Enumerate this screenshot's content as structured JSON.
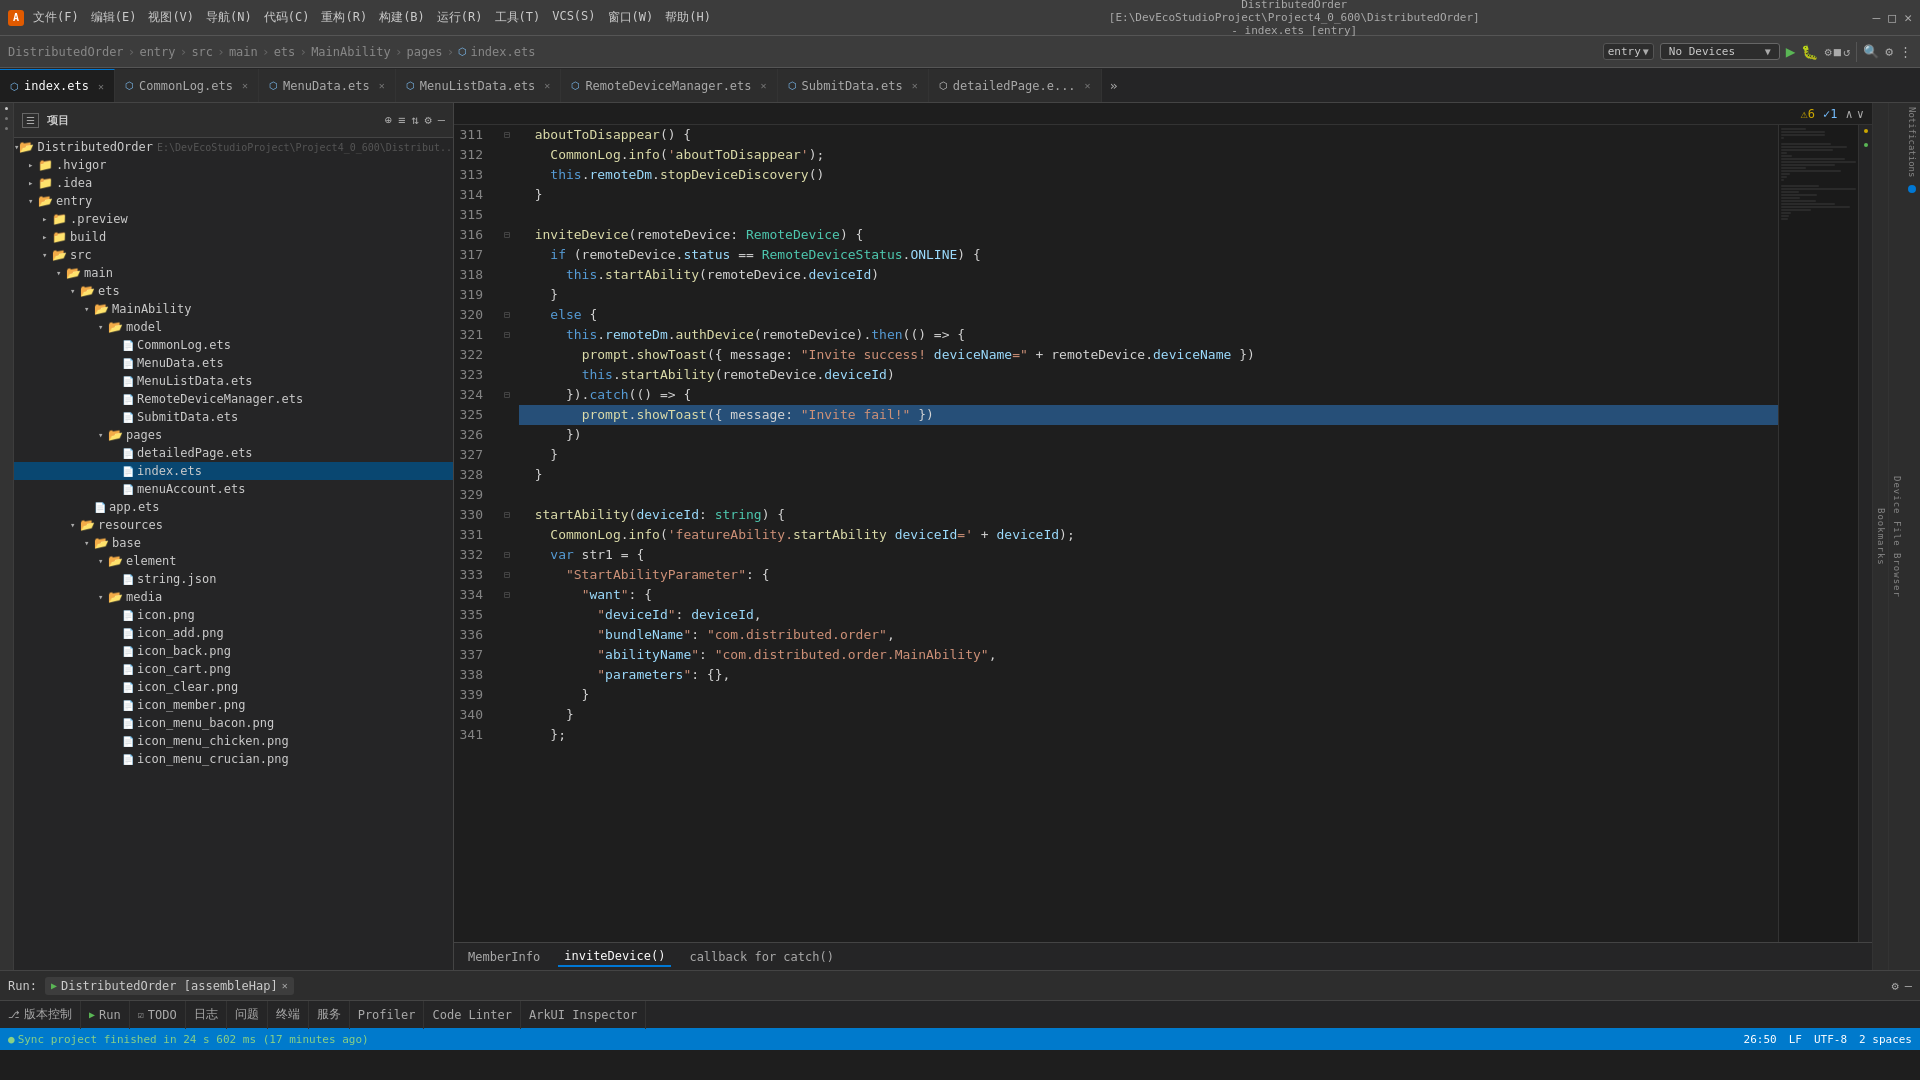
{
  "titleBar": {
    "logo": "A",
    "menus": [
      "文件(F)",
      "编辑(E)",
      "视图(V)",
      "导航(N)",
      "代码(C)",
      "重构(R)",
      "构建(B)",
      "运行(R)",
      "工具(T)",
      "VCS(S)",
      "窗口(W)",
      "帮助(H)"
    ],
    "path": "DistributedOrder [E:\\DevEcoStudioProject\\Project4_0_600\\DistributedOrder] - index.ets [entry]",
    "controls": [
      "—",
      "□",
      "✕"
    ]
  },
  "breadcrumb": {
    "items": [
      "DistributedOrder",
      "entry",
      "src",
      "main",
      "ets",
      "MainAbility",
      "pages",
      "index.ets"
    ]
  },
  "toolbar": {
    "entry_label": "entry",
    "no_devices": "No Devices",
    "run_label": "▶",
    "icons": [
      "⚙",
      "🔍",
      "⚙"
    ]
  },
  "tabs": [
    {
      "label": "index.ets",
      "active": true,
      "modified": false
    },
    {
      "label": "CommonLog.ets",
      "active": false,
      "modified": false
    },
    {
      "label": "MenuData.ets",
      "active": false,
      "modified": false
    },
    {
      "label": "MenuListData.ets",
      "active": false,
      "modified": false
    },
    {
      "label": "RemoteDeviceManager.ets",
      "active": false,
      "modified": false
    },
    {
      "label": "SubmitData.ets",
      "active": false,
      "modified": false
    },
    {
      "label": "detailedPage.e...",
      "active": false,
      "modified": false
    }
  ],
  "warnings": {
    "warn_count": "6",
    "info_count": "1"
  },
  "sidebar": {
    "header": "项目",
    "tree": [
      {
        "indent": 0,
        "type": "folder",
        "open": true,
        "label": "DistributedOrder",
        "extra": "E:\\DevEcoStudioProject\\Project4_0_600\\Distribut..."
      },
      {
        "indent": 1,
        "type": "folder",
        "open": false,
        "label": ".hvigor"
      },
      {
        "indent": 1,
        "type": "folder",
        "open": false,
        "label": ".idea"
      },
      {
        "indent": 1,
        "type": "folder",
        "open": true,
        "label": "entry"
      },
      {
        "indent": 2,
        "type": "folder",
        "open": false,
        "label": ".preview"
      },
      {
        "indent": 2,
        "type": "folder",
        "open": false,
        "label": "build"
      },
      {
        "indent": 2,
        "type": "folder",
        "open": true,
        "label": "src"
      },
      {
        "indent": 3,
        "type": "folder",
        "open": true,
        "label": "main"
      },
      {
        "indent": 4,
        "type": "folder",
        "open": true,
        "label": "ets"
      },
      {
        "indent": 5,
        "type": "folder",
        "open": true,
        "label": "MainAbility"
      },
      {
        "indent": 6,
        "type": "folder",
        "open": true,
        "label": "model"
      },
      {
        "indent": 7,
        "type": "file",
        "label": "CommonLog.ets"
      },
      {
        "indent": 7,
        "type": "file",
        "label": "MenuData.ets"
      },
      {
        "indent": 7,
        "type": "file",
        "label": "MenuListData.ets"
      },
      {
        "indent": 7,
        "type": "file",
        "label": "RemoteDeviceManager.ets"
      },
      {
        "indent": 7,
        "type": "file",
        "label": "SubmitData.ets"
      },
      {
        "indent": 6,
        "type": "folder",
        "open": true,
        "label": "pages"
      },
      {
        "indent": 7,
        "type": "file",
        "label": "detailedPage.ets"
      },
      {
        "indent": 7,
        "type": "file",
        "label": "index.ets",
        "active": true
      },
      {
        "indent": 7,
        "type": "file",
        "label": "menuAccount.ets"
      },
      {
        "indent": 5,
        "type": "file",
        "label": "app.ets"
      },
      {
        "indent": 4,
        "type": "folder",
        "open": true,
        "label": "resources"
      },
      {
        "indent": 5,
        "type": "folder",
        "open": true,
        "label": "base"
      },
      {
        "indent": 6,
        "type": "folder",
        "open": true,
        "label": "element"
      },
      {
        "indent": 7,
        "type": "file",
        "label": "string.json"
      },
      {
        "indent": 6,
        "type": "folder",
        "open": true,
        "label": "media"
      },
      {
        "indent": 7,
        "type": "file",
        "label": "icon.png"
      },
      {
        "indent": 7,
        "type": "file",
        "label": "icon_add.png"
      },
      {
        "indent": 7,
        "type": "file",
        "label": "icon_back.png"
      },
      {
        "indent": 7,
        "type": "file",
        "label": "icon_cart.png"
      },
      {
        "indent": 7,
        "type": "file",
        "label": "icon_clear.png"
      },
      {
        "indent": 7,
        "type": "file",
        "label": "icon_member.png"
      },
      {
        "indent": 7,
        "type": "file",
        "label": "icon_menu_bacon.png"
      },
      {
        "indent": 7,
        "type": "file",
        "label": "icon_menu_chicken.png"
      },
      {
        "indent": 7,
        "type": "file",
        "label": "icon_menu_crucian.png"
      }
    ]
  },
  "codeLines": [
    {
      "num": 311,
      "content": "  aboutToDisappear() {"
    },
    {
      "num": 312,
      "content": "    CommonLog.info('aboutToDisappear');"
    },
    {
      "num": 313,
      "content": "    this.remoteDm.stopDeviceDiscovery()"
    },
    {
      "num": 314,
      "content": "  }"
    },
    {
      "num": 315,
      "content": ""
    },
    {
      "num": 316,
      "content": "  inviteDevice(remoteDevice: RemoteDevice) {"
    },
    {
      "num": 317,
      "content": "    if (remoteDevice.status == RemoteDeviceStatus.ONLINE) {"
    },
    {
      "num": 318,
      "content": "      this.startAbility(remoteDevice.deviceId)"
    },
    {
      "num": 319,
      "content": "    }"
    },
    {
      "num": 320,
      "content": "    else {"
    },
    {
      "num": 321,
      "content": "      this.remoteDm.authDevice(remoteDevice).then(() => {"
    },
    {
      "num": 322,
      "content": "        prompt.showToast({ message: \"Invite success! deviceName=\" + remoteDevice.deviceName })"
    },
    {
      "num": 323,
      "content": "        this.startAbility(remoteDevice.deviceId)"
    },
    {
      "num": 324,
      "content": "      }).catch(() => {"
    },
    {
      "num": 325,
      "content": "        prompt.showToast({ message: \"Invite fail!\" })"
    },
    {
      "num": 326,
      "content": "      })"
    },
    {
      "num": 327,
      "content": "    }"
    },
    {
      "num": 328,
      "content": "  }"
    },
    {
      "num": 329,
      "content": ""
    },
    {
      "num": 330,
      "content": "  startAbility(deviceId: string) {"
    },
    {
      "num": 331,
      "content": "    CommonLog.info('featureAbility.startAbility deviceId=' + deviceId);"
    },
    {
      "num": 332,
      "content": "    var str1 = {"
    },
    {
      "num": 333,
      "content": "      \"StartAbilityParameter\": {"
    },
    {
      "num": 334,
      "content": "        \"want\": {"
    },
    {
      "num": 335,
      "content": "          \"deviceId\": deviceId,"
    },
    {
      "num": 336,
      "content": "          \"bundleName\": \"com.distributed.order\","
    },
    {
      "num": 337,
      "content": "          \"abilityName\": \"com.distributed.order.MainAbility\","
    },
    {
      "num": 338,
      "content": "          \"parameters\": {},"
    },
    {
      "num": 339,
      "content": "        }"
    },
    {
      "num": 340,
      "content": "      }"
    },
    {
      "num": 341,
      "content": "    };"
    }
  ],
  "bottomTabs": [
    {
      "label": "MemberInfo",
      "active": false
    },
    {
      "label": "inviteDevice()",
      "active": true
    },
    {
      "label": "callback for catch()",
      "active": false
    }
  ],
  "runBar": {
    "run_label": "Run:",
    "project": "DistributedOrder [assembleHap]",
    "close_label": "✕"
  },
  "statusBar": {
    "sync_text": "Sync project finished in 24 s 602 ms (17 minutes ago)",
    "line_col": "26:50",
    "encoding": "UTF-8",
    "line_ending": "LF",
    "indent": "2 spaces"
  },
  "bottomRunItems": [
    {
      "label": "版本控制"
    },
    {
      "label": "Run"
    },
    {
      "label": "TODO"
    },
    {
      "label": "日志"
    },
    {
      "label": "问题"
    },
    {
      "label": "终端"
    },
    {
      "label": "服务"
    },
    {
      "label": "Profiler"
    },
    {
      "label": "Code Linter"
    },
    {
      "label": "ArkUI Inspector"
    }
  ]
}
